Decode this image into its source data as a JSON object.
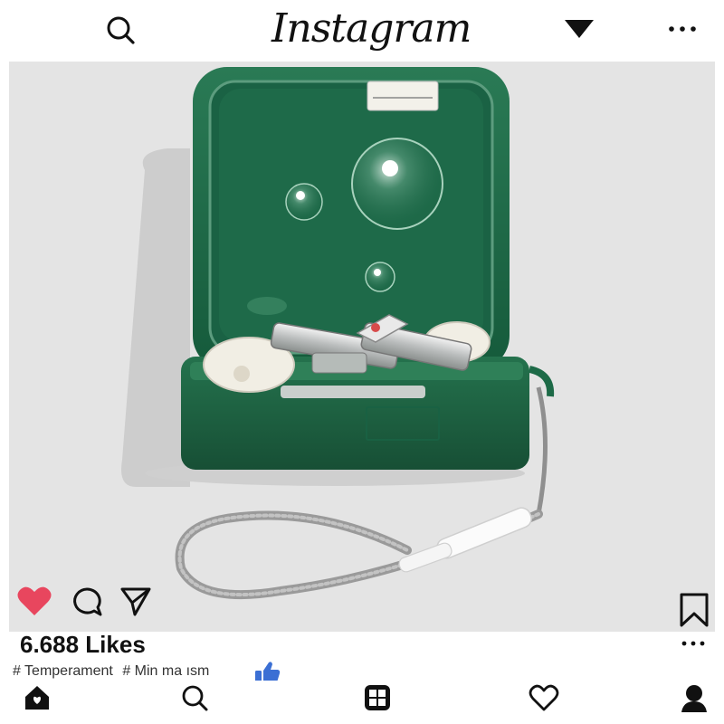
{
  "header": {
    "title": "Instagram",
    "left_icon": "search-icon",
    "dropdown_icon": "triangle-down-icon",
    "menu_icon": "more-horizontal-icon"
  },
  "post": {
    "image_icon": "earbuds-case-photo",
    "like_icon": "heart-filled-icon",
    "like_color": "#e8465e",
    "comment_icon": "comment-icon",
    "share_icon": "send-icon",
    "save_icon": "bookmark-icon",
    "likes_text": "6.688 Likes",
    "more_icon": "more-horizontal-icon",
    "hashtags": [
      "# Temperament",
      "# Min ma ısm"
    ],
    "reaction_icon": "thumbs-up-icon",
    "reaction_color": "#3b6fd4"
  },
  "bottom_nav": {
    "items": [
      {
        "icon": "home-icon",
        "active": true
      },
      {
        "icon": "search-icon",
        "active": false
      },
      {
        "icon": "new-post-icon",
        "active": false
      },
      {
        "icon": "heart-outline-icon",
        "active": false
      },
      {
        "icon": "profile-icon",
        "active": false
      }
    ]
  },
  "colors": {
    "background": "#ffffff",
    "photo_background": "#e4e4e4",
    "case_green": "#1f6b47"
  }
}
